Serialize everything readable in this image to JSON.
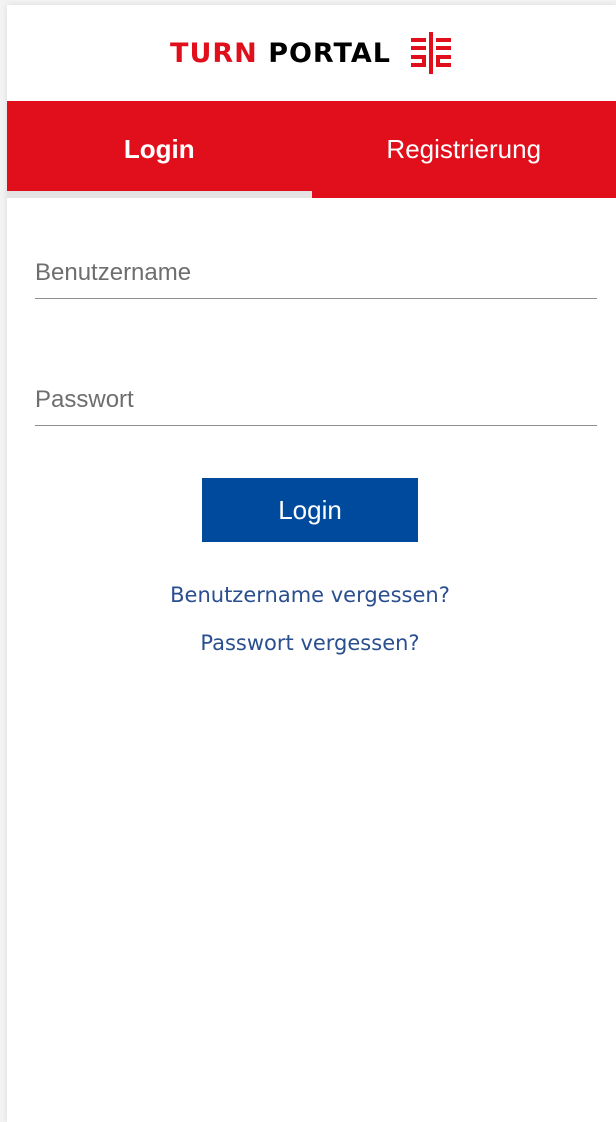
{
  "header": {
    "brand_part1": "TURN",
    "brand_part2": "PORTAL",
    "logo_icon": "turnerbund-logo-icon"
  },
  "tabs": [
    {
      "label": "Login",
      "active": true
    },
    {
      "label": "Registrierung",
      "active": false
    }
  ],
  "form": {
    "username": {
      "placeholder": "Benutzername",
      "value": ""
    },
    "password": {
      "placeholder": "Passwort",
      "value": ""
    },
    "login_label": "Login",
    "forgot_username": "Benutzername vergessen?",
    "forgot_password": "Passwort vergessen?"
  },
  "colors": {
    "brand_red": "#e10f1b",
    "button_blue": "#004a9e",
    "link_blue": "#2a4f8f"
  }
}
